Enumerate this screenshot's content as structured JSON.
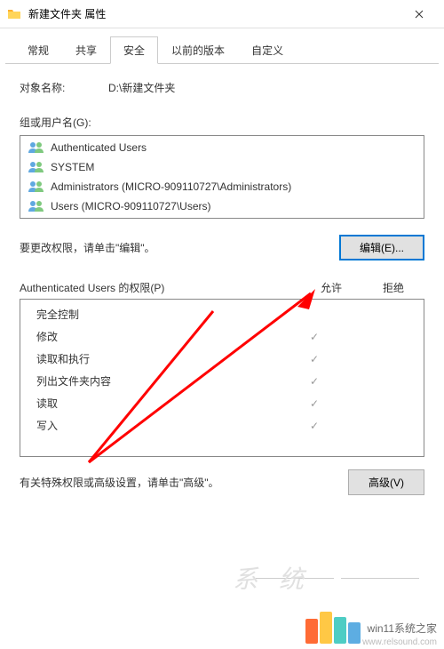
{
  "window": {
    "title": "新建文件夹 属性"
  },
  "tabs": [
    {
      "label": "常规"
    },
    {
      "label": "共享"
    },
    {
      "label": "安全",
      "active": true
    },
    {
      "label": "以前的版本"
    },
    {
      "label": "自定义"
    }
  ],
  "object": {
    "label": "对象名称:",
    "path": "D:\\新建文件夹"
  },
  "groups": {
    "label": "组或用户名(G):",
    "items": [
      {
        "name": "Authenticated Users"
      },
      {
        "name": "SYSTEM"
      },
      {
        "name": "Administrators (MICRO-909110727\\Administrators)"
      },
      {
        "name": "Users (MICRO-909110727\\Users)"
      }
    ]
  },
  "editRow": {
    "text": "要更改权限，请单击\"编辑\"。",
    "buttonLabel": "编辑(E)..."
  },
  "permissions": {
    "headerLabel": "Authenticated Users 的权限(P)",
    "allowLabel": "允许",
    "denyLabel": "拒绝",
    "rows": [
      {
        "name": "完全控制",
        "allow": false,
        "deny": false
      },
      {
        "name": "修改",
        "allow": true,
        "deny": false
      },
      {
        "name": "读取和执行",
        "allow": true,
        "deny": false
      },
      {
        "name": "列出文件夹内容",
        "allow": true,
        "deny": false
      },
      {
        "name": "读取",
        "allow": true,
        "deny": false
      },
      {
        "name": "写入",
        "allow": true,
        "deny": false
      }
    ]
  },
  "advanced": {
    "text": "有关特殊权限或高级设置，请单击\"高级\"。",
    "buttonLabel": "高级(V)"
  },
  "watermark": {
    "text": "win11系统之家",
    "url": "www.relsound.com",
    "fadedText": "系 统"
  }
}
